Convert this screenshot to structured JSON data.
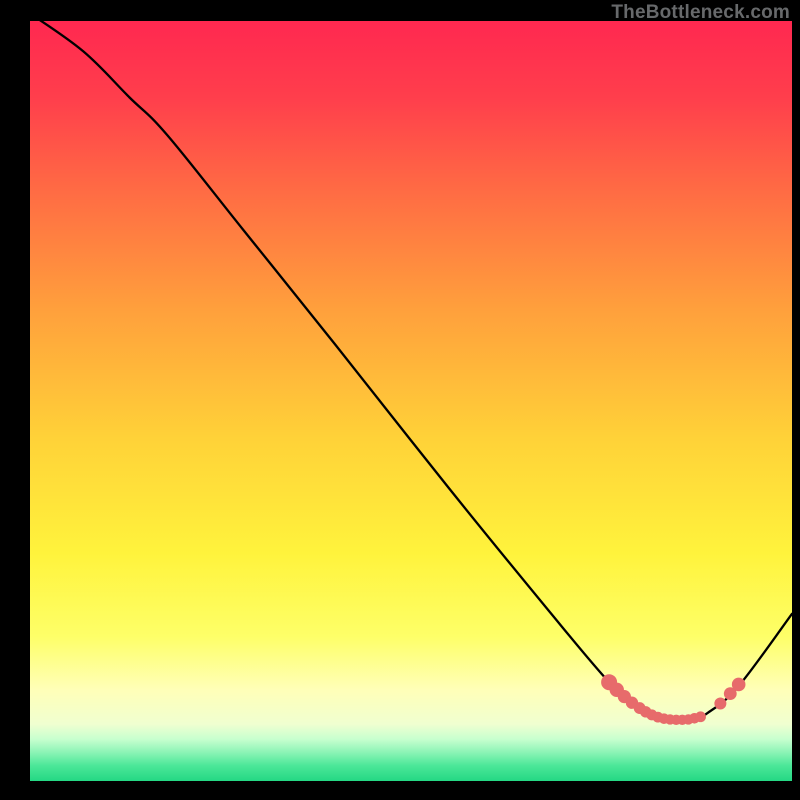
{
  "watermark": "TheBottleneck.com",
  "chart_data": {
    "type": "line",
    "title": "",
    "xlabel": "",
    "ylabel": "",
    "xlim": [
      0,
      100
    ],
    "ylim": [
      0,
      100
    ],
    "grid": false,
    "legend": false,
    "background_gradient": {
      "top": "#ff2850",
      "middle": "#ffe740",
      "near_bottom": "#ffffb8",
      "bottom_band": "#2bdd87"
    },
    "series": [
      {
        "name": "bottleneck-curve",
        "color": "#000000",
        "x": [
          0.0,
          7.0,
          13.0,
          18.0,
          28.0,
          40.0,
          55.0,
          68.0,
          76.0,
          80.0,
          82.0,
          85.0,
          87.0,
          89.0,
          93.0,
          100.0
        ],
        "y": [
          101.0,
          96.0,
          90.0,
          85.0,
          72.5,
          57.5,
          38.5,
          22.5,
          13.0,
          9.5,
          8.5,
          8.0,
          8.1,
          9.0,
          12.5,
          22.0
        ]
      }
    ],
    "markers": [
      {
        "name": "highlight-dots",
        "color": "#e76b6b",
        "shape": "circle",
        "x": [
          76.0,
          77.0,
          78.0,
          79.0,
          80.0,
          80.8,
          81.6,
          82.4,
          83.2,
          84.0,
          84.8,
          85.6,
          86.4,
          87.2,
          88.0,
          90.6,
          91.9,
          93.0
        ],
        "y": [
          13.0,
          12.0,
          11.1,
          10.3,
          9.6,
          9.1,
          8.7,
          8.4,
          8.2,
          8.1,
          8.05,
          8.05,
          8.1,
          8.25,
          8.45,
          10.2,
          11.5,
          12.7
        ],
        "r": [
          8,
          7.2,
          6.6,
          6.2,
          5.9,
          5.7,
          5.5,
          5.4,
          5.3,
          5.2,
          5.2,
          5.2,
          5.2,
          5.3,
          5.4,
          6.0,
          6.4,
          6.8
        ]
      }
    ]
  }
}
